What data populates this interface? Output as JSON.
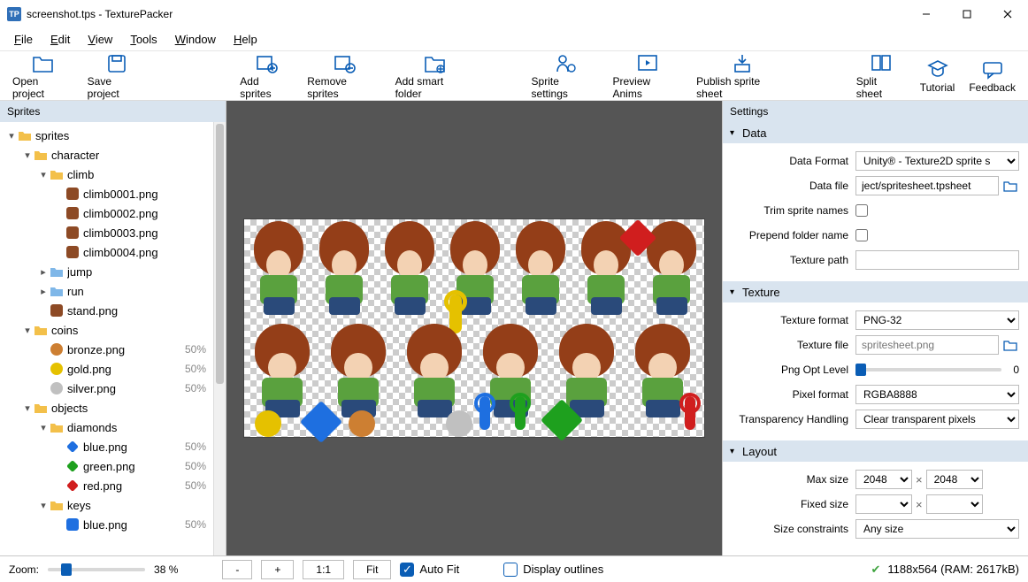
{
  "window": {
    "title": "screenshot.tps - TexturePacker",
    "app_badge": "TP"
  },
  "menu": [
    "File",
    "Edit",
    "View",
    "Tools",
    "Window",
    "Help"
  ],
  "toolbar": [
    {
      "id": "open-project",
      "label": "Open project"
    },
    {
      "id": "save-project",
      "label": "Save project"
    },
    {
      "id": "add-sprites",
      "label": "Add sprites"
    },
    {
      "id": "remove-sprites",
      "label": "Remove sprites"
    },
    {
      "id": "add-smart-folder",
      "label": "Add smart folder"
    },
    {
      "id": "sprite-settings",
      "label": "Sprite settings"
    },
    {
      "id": "preview-anims",
      "label": "Preview Anims"
    },
    {
      "id": "publish-sprite-sheet",
      "label": "Publish sprite sheet"
    },
    {
      "id": "split-sheet",
      "label": "Split sheet"
    },
    {
      "id": "tutorial",
      "label": "Tutorial"
    },
    {
      "id": "feedback",
      "label": "Feedback"
    }
  ],
  "sprites_panel": {
    "title": "Sprites",
    "tree": [
      {
        "depth": 0,
        "tw": "▾",
        "type": "folder",
        "label": "sprites"
      },
      {
        "depth": 1,
        "tw": "▾",
        "type": "folder",
        "label": "character"
      },
      {
        "depth": 2,
        "tw": "▾",
        "type": "folder",
        "label": "climb"
      },
      {
        "depth": 3,
        "tw": "",
        "type": "sprite",
        "thumb": "#8d4a25",
        "label": "climb0001.png"
      },
      {
        "depth": 3,
        "tw": "",
        "type": "sprite",
        "thumb": "#8d4a25",
        "label": "climb0002.png"
      },
      {
        "depth": 3,
        "tw": "",
        "type": "sprite",
        "thumb": "#8d4a25",
        "label": "climb0003.png"
      },
      {
        "depth": 3,
        "tw": "",
        "type": "sprite",
        "thumb": "#8d4a25",
        "label": "climb0004.png"
      },
      {
        "depth": 2,
        "tw": "▸",
        "type": "folder",
        "label": "jump"
      },
      {
        "depth": 2,
        "tw": "▸",
        "type": "folder",
        "label": "run"
      },
      {
        "depth": 2,
        "tw": "",
        "type": "sprite",
        "thumb": "#8d4a25",
        "label": "stand.png"
      },
      {
        "depth": 1,
        "tw": "▾",
        "type": "folder",
        "label": "coins"
      },
      {
        "depth": 2,
        "tw": "",
        "type": "circle",
        "thumb": "#cd7f32",
        "label": "bronze.png",
        "pct": "50%"
      },
      {
        "depth": 2,
        "tw": "",
        "type": "circle",
        "thumb": "#e5c100",
        "label": "gold.png",
        "pct": "50%"
      },
      {
        "depth": 2,
        "tw": "",
        "type": "circle",
        "thumb": "#c0c0c0",
        "label": "silver.png",
        "pct": "50%"
      },
      {
        "depth": 1,
        "tw": "▾",
        "type": "folder",
        "label": "objects"
      },
      {
        "depth": 2,
        "tw": "▾",
        "type": "folder",
        "label": "diamonds"
      },
      {
        "depth": 3,
        "tw": "",
        "type": "diamond",
        "thumb": "#1e6fe0",
        "label": "blue.png",
        "pct": "50%"
      },
      {
        "depth": 3,
        "tw": "",
        "type": "diamond",
        "thumb": "#1ea01e",
        "label": "green.png",
        "pct": "50%"
      },
      {
        "depth": 3,
        "tw": "",
        "type": "diamond",
        "thumb": "#d01e1e",
        "label": "red.png",
        "pct": "50%"
      },
      {
        "depth": 2,
        "tw": "▾",
        "type": "folder",
        "label": "keys"
      },
      {
        "depth": 3,
        "tw": "",
        "type": "key",
        "thumb": "#1e6fe0",
        "label": "blue.png",
        "pct": "50%"
      }
    ]
  },
  "settings_panel": {
    "title": "Settings",
    "sections": {
      "data": {
        "title": "Data",
        "data_format_label": "Data Format",
        "data_format_value": "Unity® - Texture2D sprite s",
        "data_file_label": "Data file",
        "data_file_value": "ject/spritesheet.tpsheet",
        "trim_label": "Trim sprite names",
        "trim_checked": false,
        "prepend_label": "Prepend folder name",
        "prepend_checked": false,
        "texture_path_label": "Texture path",
        "texture_path_value": ""
      },
      "texture": {
        "title": "Texture",
        "format_label": "Texture format",
        "format_value": "PNG-32",
        "file_label": "Texture file",
        "file_placeholder": "spritesheet.png",
        "png_opt_label": "Png Opt Level",
        "png_opt_value": "0",
        "pixel_format_label": "Pixel format",
        "pixel_format_value": "RGBA8888",
        "transparency_label": "Transparency Handling",
        "transparency_value": "Clear transparent pixels"
      },
      "layout": {
        "title": "Layout",
        "max_size_label": "Max size",
        "max_w": "2048",
        "max_h": "2048",
        "fixed_size_label": "Fixed size",
        "fixed_w": "",
        "fixed_h": "",
        "constraints_label": "Size constraints",
        "constraints_value": "Any size"
      }
    }
  },
  "bottombar": {
    "zoom_label": "Zoom:",
    "zoom_pct": "38 %",
    "btn_minus": "-",
    "btn_plus": "+",
    "btn_11": "1:1",
    "btn_fit": "Fit",
    "auto_fit": "Auto Fit",
    "auto_fit_checked": true,
    "display_outlines": "Display outlines",
    "display_outlines_checked": false,
    "status": "1188x564 (RAM: 2617kB)"
  }
}
